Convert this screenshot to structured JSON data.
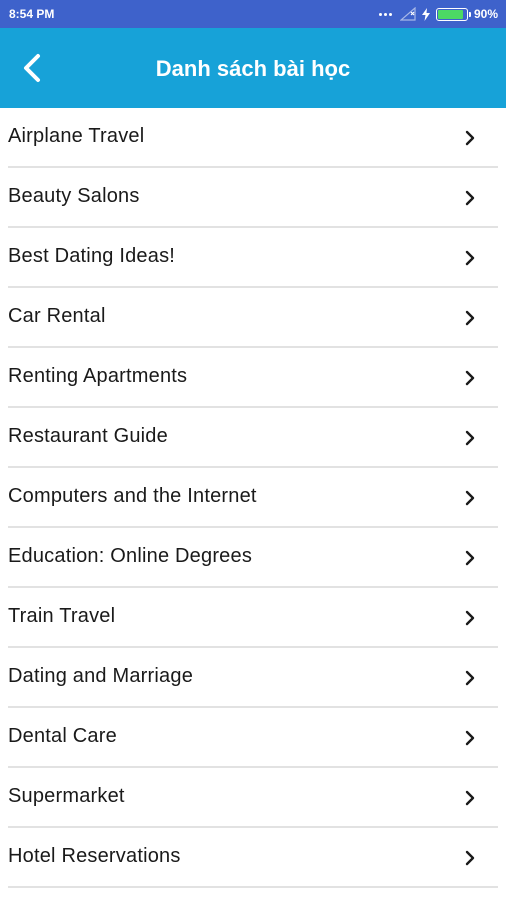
{
  "status_bar": {
    "time": "8:54 PM",
    "battery_percent": "90%",
    "battery_level": 0.9
  },
  "colors": {
    "status_bar_bg": "#3e62cb",
    "app_bar_bg": "#17a2d8",
    "text": "#1a1a1a",
    "divider": "#e2e2e2"
  },
  "icons": {
    "back": "chevron-left-icon",
    "item": "chevron-right-icon"
  },
  "header": {
    "title": "Danh sách bài học"
  },
  "lessons": [
    {
      "label": "Airplane Travel"
    },
    {
      "label": "Beauty Salons"
    },
    {
      "label": "Best Dating Ideas!"
    },
    {
      "label": "Car Rental"
    },
    {
      "label": "Renting Apartments"
    },
    {
      "label": "Restaurant Guide"
    },
    {
      "label": "Computers and the Internet"
    },
    {
      "label": "Education: Online Degrees"
    },
    {
      "label": "Train Travel"
    },
    {
      "label": "Dating and Marriage"
    },
    {
      "label": "Dental Care"
    },
    {
      "label": "Supermarket"
    },
    {
      "label": "Hotel Reservations"
    }
  ]
}
